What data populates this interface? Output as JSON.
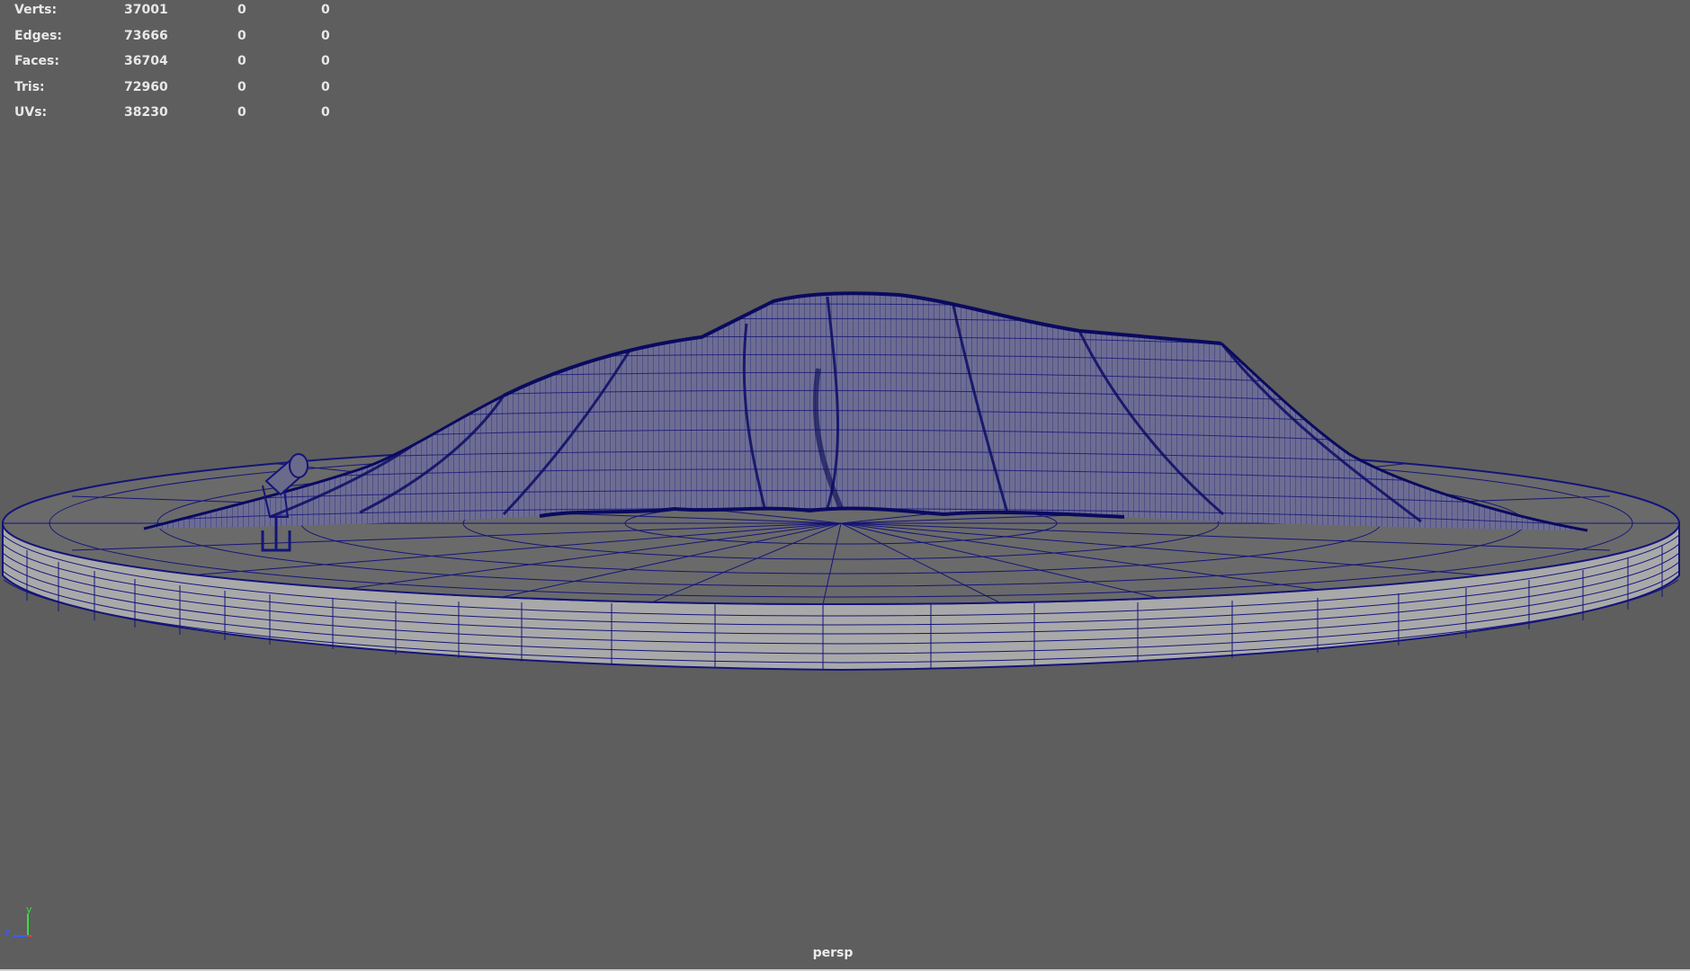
{
  "viewport": {
    "camera": "persp",
    "background_color": "#5e5e5e",
    "wireframe_color": "#14147a"
  },
  "hud": {
    "rows": [
      {
        "label": "Verts:",
        "total": "37001",
        "selected": "0",
        "selected_alt": "0"
      },
      {
        "label": "Edges:",
        "total": "73666",
        "selected": "0",
        "selected_alt": "0"
      },
      {
        "label": "Faces:",
        "total": "36704",
        "selected": "0",
        "selected_alt": "0"
      },
      {
        "label": "Tris:",
        "total": "72960",
        "selected": "0",
        "selected_alt": "0"
      },
      {
        "label": "UVs:",
        "total": "38230",
        "selected": "0",
        "selected_alt": "0"
      }
    ]
  },
  "axis_gizmo": {
    "y_label": "y",
    "z_label": "z",
    "y_color": "#3ddc3d",
    "z_color": "#3a5cff",
    "x_color": "#e04040"
  },
  "scene_objects": [
    "cloth-mesh-icon",
    "base-disc-icon",
    "lamp-icon"
  ]
}
